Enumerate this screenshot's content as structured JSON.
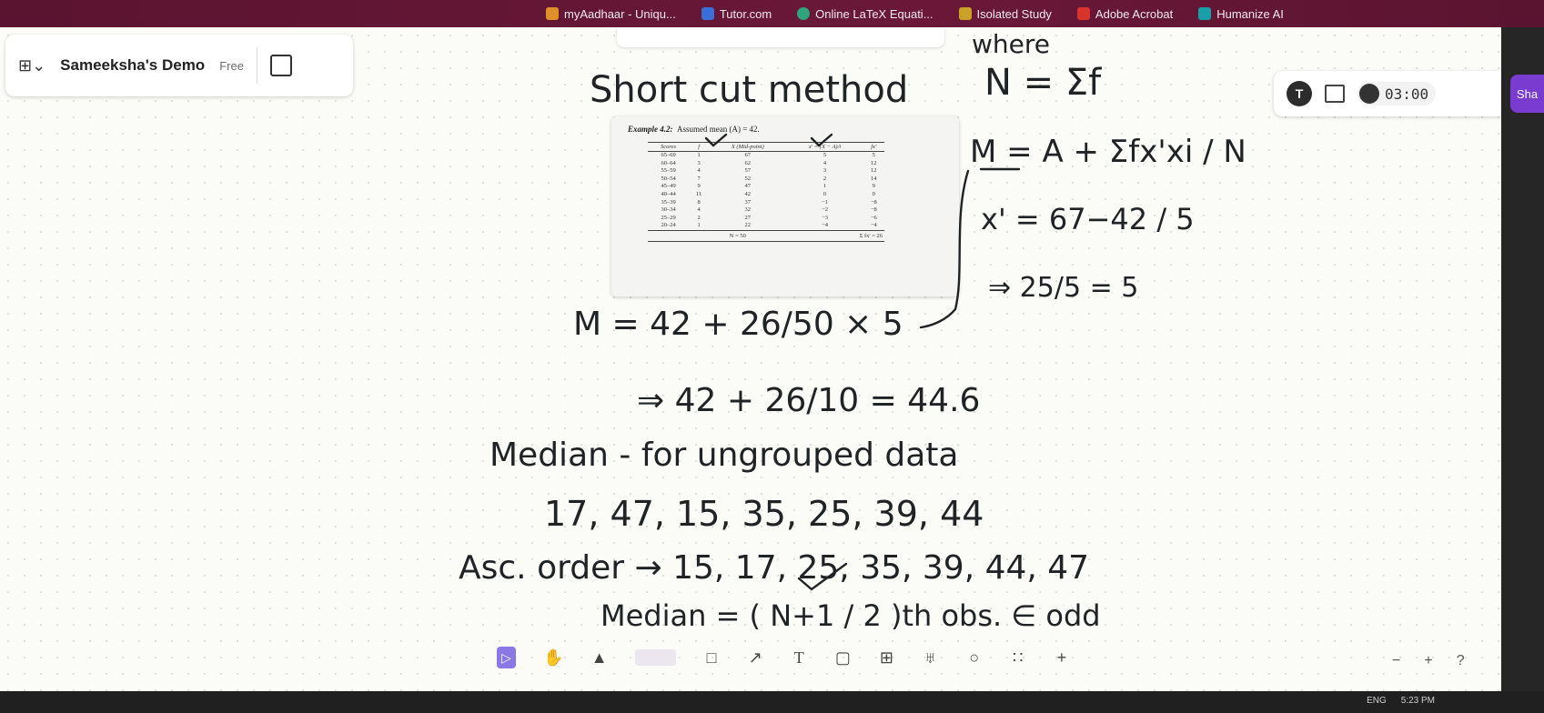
{
  "bookmarks": [
    {
      "label": "myAadhaar - Uniqu...",
      "icon": "aadhaar-icon",
      "color": "#e0902a"
    },
    {
      "label": "Tutor.com",
      "icon": "tutor-icon",
      "color": "#3a6fd8"
    },
    {
      "label": "Online LaTeX Equati...",
      "icon": "latex-icon",
      "color": "#2fa37a"
    },
    {
      "label": "Isolated Study",
      "icon": "study-icon",
      "color": "#c9a227"
    },
    {
      "label": "Adobe Acrobat",
      "icon": "acrobat-icon",
      "color": "#d9342b"
    },
    {
      "label": "Humanize AI",
      "icon": "humanize-icon",
      "color": "#18a0a8"
    }
  ],
  "workspace": {
    "name": "Sameeksha's Demo",
    "badge": "Free"
  },
  "topbar": {
    "timer": "03:00",
    "avatar_letter": "T",
    "share_label": "Sha",
    "accent_color": "#7a3bd1"
  },
  "example": {
    "caption_bold": "Example 4.2:",
    "caption_rest": "Assumed mean (A) = 42.",
    "headers": [
      "Scores",
      "f",
      "X (Mid-point)",
      "x' = (X − A)/i",
      "fx'"
    ],
    "rows": [
      [
        "65–69",
        "1",
        "67",
        "5",
        "5"
      ],
      [
        "60–64",
        "3",
        "62",
        "4",
        "12"
      ],
      [
        "55–59",
        "4",
        "57",
        "3",
        "12"
      ],
      [
        "50–54",
        "7",
        "52",
        "2",
        "14"
      ],
      [
        "45–49",
        "9",
        "47",
        "1",
        "9"
      ],
      [
        "40–44",
        "11",
        "42",
        "0",
        "0"
      ],
      [
        "35–39",
        "8",
        "37",
        "−1",
        "−8"
      ],
      [
        "30–34",
        "4",
        "32",
        "−2",
        "−8"
      ],
      [
        "25–29",
        "2",
        "27",
        "−3",
        "−6"
      ],
      [
        "20–24",
        "1",
        "22",
        "−4",
        "−4"
      ]
    ],
    "total_n": "N = 50",
    "total_fx": "Σ fx' = 26"
  },
  "handwriting": {
    "title": "Short cut method",
    "where": "where",
    "n_def": "N = Σf",
    "mean_formula": "M = A + Σfx'xi / N",
    "x_prime": "x' = 67−42 / 5",
    "x_result": "⇒ 25/5 = 5",
    "m_calc": "M = 42 + 26/50 × 5",
    "m_result": "⇒ 42 + 26/10 = 44.6",
    "median_heading": "Median - for ungrouped data",
    "raw_data": "17, 47, 15, 35, 25, 39, 44",
    "ascending": "Asc. order → 15, 17, 25, 35, 39, 44, 47",
    "median_formula": "Median = ( N+1 / 2 )th obs. ∈ odd"
  },
  "toolbar": {
    "tools": [
      "pointer-tool",
      "hand-tool",
      "pen-tool",
      "highlighter-tool",
      "shape-tool",
      "connector-tool",
      "text-tool",
      "sticky-note-tool",
      "table-tool",
      "stamp-tool",
      "circle-tool",
      "group-tool",
      "add-tool"
    ],
    "active_color": "#8b78e6"
  },
  "zoom": {
    "minus": "−",
    "plus": "+",
    "help": "?"
  },
  "taskbar": {
    "lang": "ENG",
    "time": "5:23 PM"
  }
}
